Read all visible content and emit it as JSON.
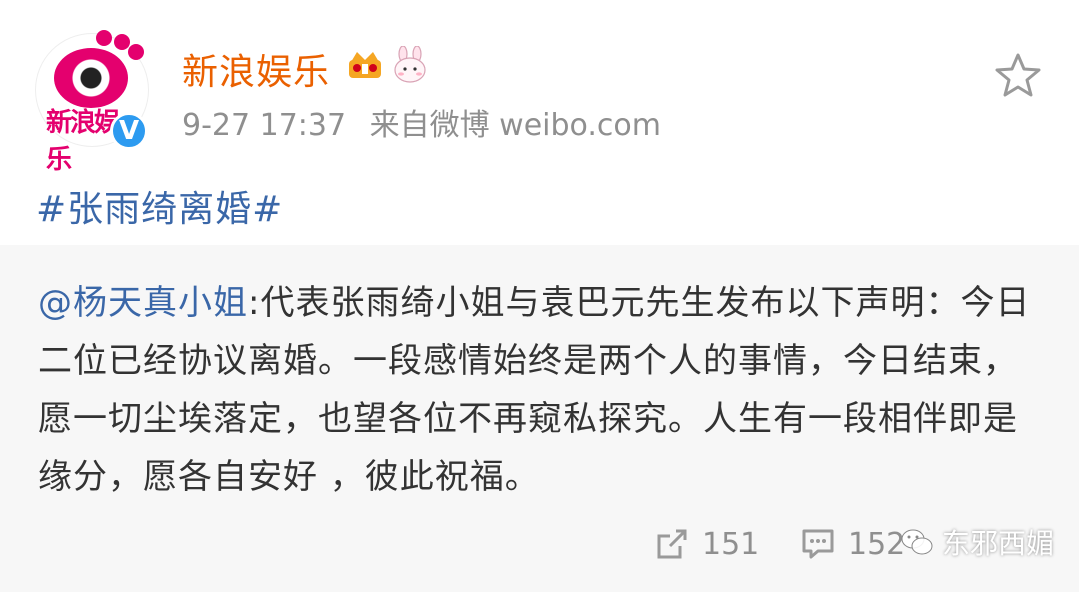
{
  "post": {
    "author": {
      "name": "新浪娱乐",
      "avatar_text": "新浪娱乐",
      "verified_mark": "V"
    },
    "timestamp": "9-27 17:37",
    "source": "来自微博 weibo.com",
    "hashtag": "#张雨绮离婚#"
  },
  "repost": {
    "mention": "@杨天真小姐",
    "body": ":代表张雨绮小姐与袁巴元先生发布以下声明：今日二位已经协议离婚。一段感情始终是两个人的事情，今日结束，愿一切尘埃落定，也望各位不再窥私探究。人生有一段相伴即是缘分，愿各自安好 ，彼此祝福。",
    "repost_count": "151",
    "comment_count": "152"
  },
  "watermark": {
    "text": "东邪西媚"
  },
  "icons": {
    "star": "star-outline-icon",
    "repost": "repost-icon",
    "comment": "comment-icon",
    "crown": "crown-badge-icon",
    "bunny": "bunny-badge-icon",
    "wechat": "wechat-icon"
  },
  "colors": {
    "username": "#ea6000",
    "link": "#3a67a8",
    "meta": "#8f8f8f",
    "card_bg": "#f7f7f7",
    "brand": "#e4006e",
    "verified": "#2d9bf0"
  }
}
